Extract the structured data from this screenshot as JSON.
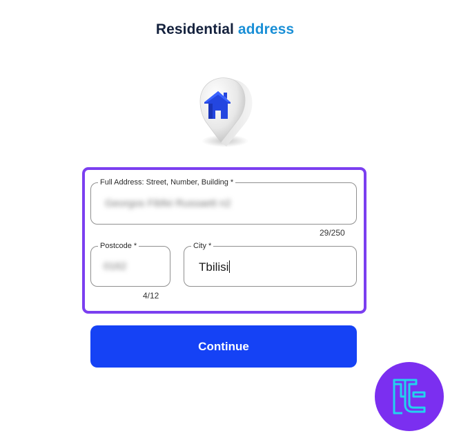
{
  "header": {
    "title_part1": "Residential",
    "title_part2": "address"
  },
  "illustration": {
    "icon": "home-location-pin-icon"
  },
  "form": {
    "full_address": {
      "label": "Full Address: Street, Number, Building *",
      "value": "Georgos Fibfei Russaett n2",
      "counter": "29/250"
    },
    "postcode": {
      "label": "Postcode *",
      "value": "0162",
      "counter": "4/12"
    },
    "city": {
      "label": "City *",
      "value": "Tbilisi"
    }
  },
  "actions": {
    "continue_label": "Continue"
  },
  "colors": {
    "title_dark": "#14213d",
    "title_accent": "#1a8fd6",
    "focus_border": "#7b3ff0",
    "button": "#1542f5",
    "logo_bg": "#7b2ff0",
    "logo_stroke": "#22d3ee"
  },
  "brand": {
    "logo": "brand-logo-icon"
  }
}
